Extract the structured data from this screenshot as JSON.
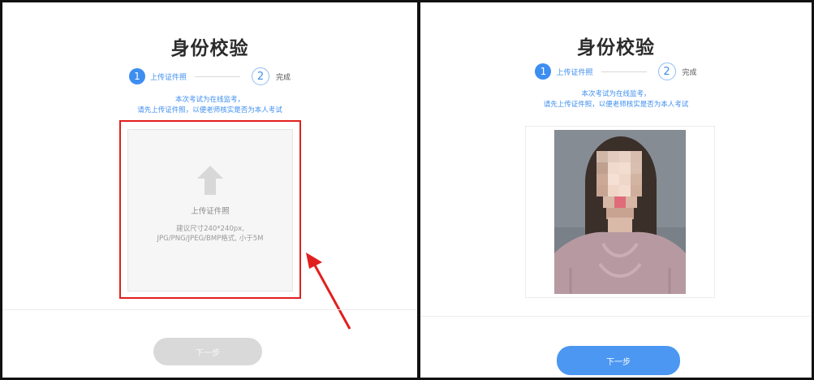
{
  "left_panel": {
    "title": "身份校验",
    "steps": [
      {
        "number": "1",
        "label": "上传证件照"
      },
      {
        "number": "2",
        "label": "完成"
      }
    ],
    "notice_line1": "本次考试为在线监考，",
    "notice_line2": "请先上传证件照，以便老师核实是否为本人考试",
    "upload": {
      "title": "上传证件照",
      "hint_line1": "建议尺寸240*240px,",
      "hint_line2": "JPG/PNG/JPEG/BMP格式, 小于5M"
    },
    "next_label": "下一步"
  },
  "right_panel": {
    "title": "身份校验",
    "steps": [
      {
        "number": "1",
        "label": "上传证件照"
      },
      {
        "number": "2",
        "label": "完成"
      }
    ],
    "notice_line1": "本次考试为在线监考，",
    "notice_line2": "请先上传证件照，以便老师核实是否为本人考试",
    "next_label": "下一步"
  },
  "colors": {
    "accent": "#3d8ef0",
    "highlight": "#e21f1f",
    "button_disabled": "#d9d9d9",
    "button_enabled": "#4b97f1"
  },
  "icons": {
    "upload": "upload-arrow-icon",
    "callout": "red-arrow-icon"
  }
}
